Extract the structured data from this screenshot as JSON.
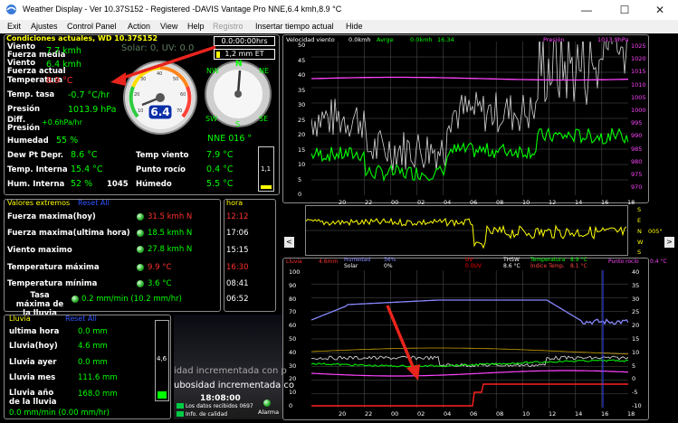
{
  "window": {
    "title": "Weather Display - Ver 10.37S152 - Registered  -DAVIS Vantage Pro NNE,6.4 kmh,8.9 °C",
    "minimize": "—",
    "maximize": "☐",
    "close": "✕"
  },
  "menu": [
    "Exit",
    "Ajustes",
    "Control Panel",
    "Action",
    "View",
    "Help",
    "Registro",
    "Insertar tiempo actual",
    "Hide"
  ],
  "current": {
    "title": "Condiciones actuales, WD 10.37S152",
    "clock": "0.0:00:00hrs",
    "et": "1,2 mm ET",
    "solar_uv": "Solar: 0, UV: 0.0",
    "rows": [
      {
        "label": "Viento",
        "value": "7.7 kmh"
      },
      {
        "label": "Fuerza media",
        "value": ""
      },
      {
        "label": "Viento",
        "value": "6.4 kmh"
      },
      {
        "label": "Fuerza actual",
        "value": ""
      },
      {
        "label": "Temperatura",
        "value": "8.9 °C"
      },
      {
        "label": "Temp. tasa",
        "value": "-0.7 °C/hr"
      },
      {
        "label": "Presión",
        "value": "1013.9 hPa"
      },
      {
        "label": "Diff.",
        "value": "+0.6hPa/hr"
      },
      {
        "label": "Presión",
        "value": ""
      },
      {
        "label": "Humedad",
        "value": "55 %"
      },
      {
        "label": "Dew Pt Depr.",
        "value": "8.6 °C"
      },
      {
        "label": "Temp. Interna",
        "value": "15.4 °C"
      },
      {
        "label": "Hum. Interna",
        "value": "52 %"
      }
    ],
    "extra_number": "1045",
    "right_rows": [
      {
        "label": "Temp viento",
        "value": "7.9 °C"
      },
      {
        "label": "Punto rocío",
        "value": "0.4 °C"
      },
      {
        "label": "Húmedo",
        "value": "5.5 °C"
      }
    ],
    "gauge_value": "6.4",
    "gauge_ticks": [
      "10",
      "20",
      "30",
      "40",
      "50",
      "60",
      "70"
    ],
    "compass": {
      "n": "N",
      "ne": "NE",
      "nw": "NW",
      "sw": "SW",
      "se": "SE",
      "s": "S"
    },
    "direction": "NNE  016 °",
    "bar_value": "1,1"
  },
  "extremes": {
    "title": "Valores extremos",
    "reset": "Reset All",
    "hora_title": "hora",
    "rows": [
      {
        "label": "Fuerza maxima(hoy)",
        "value": "31.5 kmh  N",
        "time": "12:12",
        "color": "#ff3030"
      },
      {
        "label": "Fuerza maxima(ultima hora)",
        "value": "18.5 kmh  N",
        "time": "17:06",
        "color": "#00ff00"
      },
      {
        "label": "Viento maximo",
        "value": "27.8 kmh  N",
        "time": "15:15",
        "color": "#00ff00"
      },
      {
        "label": "Temperatura máxima",
        "value": "9.9 °C",
        "time": "16:30",
        "color": "#ff3030"
      },
      {
        "label": "Temperatura mínima",
        "value": "3.6 °C",
        "time": "08:41",
        "color": "#00ff00"
      },
      {
        "label": "Tasa máxima de la lluvia",
        "value": "0.2 mm/min (10.2 mm/hr)",
        "time": "06:52",
        "color": "#00ff00"
      }
    ]
  },
  "rain": {
    "title": "Lluvia",
    "reset": "Reset All",
    "rows": [
      {
        "label": "ultima hora",
        "value": "0.0 mm"
      },
      {
        "label": "Lluvia(hoy)",
        "value": "4.6 mm"
      },
      {
        "label": "Lluvia ayer",
        "value": "0.0 mm"
      },
      {
        "label": "Lluvia mes",
        "value": "111.6 mm"
      },
      {
        "label": "Lluvia año de la lluvia",
        "value": "168.0 mm"
      }
    ],
    "rate": "0.0 mm/min (0.00 mm/hr)",
    "gauge_value": "4,6"
  },
  "ticker": {
    "line1": "idad incrementada con p",
    "line2": "ubosidad incrementada co",
    "time": "18:08:00",
    "legend1": "Los datos recibidos  0697",
    "legend2": "Info. de calidad",
    "alarm": "Alarma"
  },
  "wind_graph": {
    "header": [
      "Velocidad viento",
      "0.0kmh",
      "Avrge",
      "0.0kmh",
      "16.34"
    ],
    "pressure_label": "Presión",
    "pressure_value": "1013.9hPa",
    "left_ticks": [
      "50",
      "45",
      "40",
      "35",
      "30",
      "25",
      "20",
      "15",
      "10",
      "5",
      "0"
    ],
    "right_ticks": [
      "1025",
      "1020",
      "1015",
      "1010",
      "1005",
      "1000",
      "995",
      "990",
      "985",
      "980",
      "975",
      "970"
    ],
    "x_ticks": [
      "20",
      "22",
      "00",
      "02",
      "04",
      "06",
      "08",
      "10",
      "12",
      "14",
      "16",
      "18"
    ]
  },
  "dir_graph": {
    "side_letters": [
      "S",
      "E",
      "N",
      "W",
      "S"
    ],
    "value": "005°",
    "nav_left": "<",
    "nav_right": ">"
  },
  "multi_graph": {
    "header": [
      {
        "text": "Lluvia",
        "color": "#ff3030"
      },
      {
        "text": "4.6mm",
        "color": "#ff3030"
      },
      {
        "text": "Humedad",
        "color": "#8888ff"
      },
      {
        "text": "56%",
        "color": "#8888ff"
      },
      {
        "text": "Solar",
        "color": "#ffffff"
      },
      {
        "text": "0%",
        "color": "#ffffff"
      },
      {
        "text": "UV",
        "color": "#ff0000"
      },
      {
        "text": "0.0UV",
        "color": "#ff0000"
      },
      {
        "text": "THSW",
        "color": "#ffffff"
      },
      {
        "text": "8.6 °C",
        "color": "#ffffff"
      },
      {
        "text": "Temperatura",
        "color": "#00ff00"
      },
      {
        "text": "Índice Temp.",
        "color": "#ff4444"
      },
      {
        "text": "8.9 °C",
        "color": "#00ff00"
      },
      {
        "text": "8.1 °C",
        "color": "#ff4444"
      },
      {
        "text": "Punto rocío",
        "color": "#ff44ff"
      },
      {
        "text": "0.4 °C",
        "color": "#ff44ff"
      }
    ],
    "left_ticks": [
      "100",
      "90",
      "80",
      "70",
      "60",
      "50",
      "40",
      "30",
      "20",
      "10",
      "0"
    ],
    "right_ticks": [
      "40",
      "35",
      "30",
      "25",
      "20",
      "15",
      "10",
      "5",
      "0",
      "-5",
      "-10"
    ],
    "x_ticks": [
      "20",
      "22",
      "00",
      "02",
      "04",
      "06",
      "08",
      "10",
      "12",
      "14",
      "16",
      "18"
    ]
  },
  "colors": {
    "accent": "#00ff00",
    "alert": "#ff3030",
    "title": "#ffff00",
    "annotation": "#e8241c"
  }
}
